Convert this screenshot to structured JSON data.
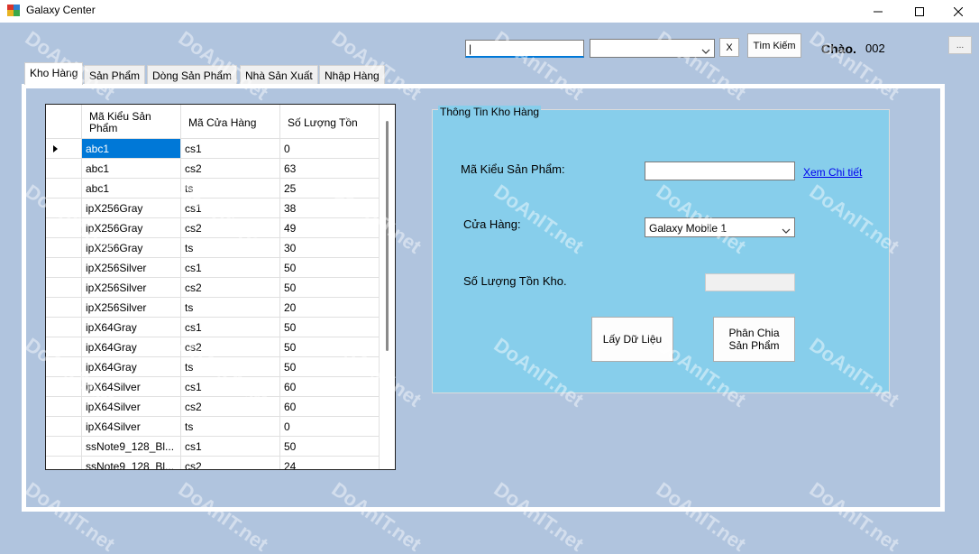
{
  "window": {
    "title": "Galaxy Center"
  },
  "toolbar": {
    "search_value": "|",
    "filter_value": "",
    "clear_label": "X",
    "search_label": "Tìm Kiếm",
    "greeting": "Chào.",
    "user": "002",
    "menu_label": "..."
  },
  "tabs": [
    {
      "label": "Kho Hàng",
      "active": true
    },
    {
      "label": "Sản Phẩm",
      "active": false
    },
    {
      "label": "Dòng Sản Phẩm",
      "active": false
    },
    {
      "label": "Nhà Sản Xuất",
      "active": false
    },
    {
      "label": "Nhập Hàng",
      "active": false
    }
  ],
  "grid": {
    "columns": [
      "Mã Kiểu Sản Phẩm",
      "Mã Cửa Hàng",
      "Số Lượng Tồn"
    ],
    "rows": [
      [
        "abc1",
        "cs1",
        "0"
      ],
      [
        "abc1",
        "cs2",
        "63"
      ],
      [
        "abc1",
        "ts",
        "25"
      ],
      [
        "ipX256Gray",
        "cs1",
        "38"
      ],
      [
        "ipX256Gray",
        "cs2",
        "49"
      ],
      [
        "ipX256Gray",
        "ts",
        "30"
      ],
      [
        "ipX256Silver",
        "cs1",
        "50"
      ],
      [
        "ipX256Silver",
        "cs2",
        "50"
      ],
      [
        "ipX256Silver",
        "ts",
        "20"
      ],
      [
        "ipX64Gray",
        "cs1",
        "50"
      ],
      [
        "ipX64Gray",
        "cs2",
        "50"
      ],
      [
        "ipX64Gray",
        "ts",
        "50"
      ],
      [
        "ipX64Silver",
        "cs1",
        "60"
      ],
      [
        "ipX64Silver",
        "cs2",
        "60"
      ],
      [
        "ipX64Silver",
        "ts",
        "0"
      ],
      [
        "ssNote9_128_Bl...",
        "cs1",
        "50"
      ],
      [
        "ssNote9_128_Bl...",
        "cs2",
        "24"
      ]
    ],
    "selected_row": 0
  },
  "info": {
    "title": "Thông Tin Kho Hàng",
    "product_label": "Mã Kiểu Sản Phẩm:",
    "product_value": "",
    "detail_link": "Xem Chi tiết",
    "store_label": "Cửa Hàng:",
    "store_value": "Galaxy Mobile 1",
    "stock_label": "Số Lượng Tồn Kho.",
    "stock_value": "",
    "load_button": "Lấy Dữ Liệu",
    "split_button": "Phân Chia Sản Phẩm"
  },
  "watermark": {
    "text": "DoAnIT.net"
  },
  "colors": {
    "background": "#b0c4de",
    "groupbox": "#87ceeb",
    "selection": "#0078d7",
    "link": "#0000ee"
  }
}
